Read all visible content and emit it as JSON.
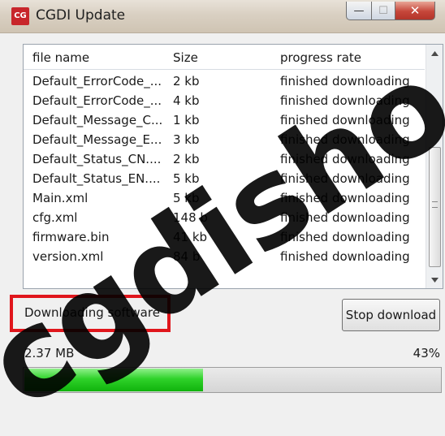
{
  "window": {
    "title": "CGDI Update",
    "icon": "cgdi-logo-icon",
    "icon_text": "CG",
    "controls": {
      "minimize": "—",
      "maximize": "☐",
      "close": "✕"
    }
  },
  "list": {
    "columns": [
      "file name",
      "Size",
      "progress rate"
    ],
    "rows": [
      [
        "Default_ErrorCode_...",
        "2 kb",
        "finished downloading"
      ],
      [
        "Default_ErrorCode_...",
        "4 kb",
        "finished downloading"
      ],
      [
        "Default_Message_C...",
        "1 kb",
        "finished downloading"
      ],
      [
        "Default_Message_E...",
        "3 kb",
        "finished downloading"
      ],
      [
        "Default_Status_CN....",
        "2 kb",
        "finished downloading"
      ],
      [
        "Default_Status_EN....",
        "5 kb",
        "finished downloading"
      ],
      [
        "Main.xml",
        "5 kb",
        "finished downloading"
      ],
      [
        "cfg.xml",
        "148 b",
        "finished downloading"
      ],
      [
        "firmware.bin",
        "41 kb",
        "finished downloading"
      ],
      [
        "version.xml",
        "84 b",
        "finished downloading"
      ]
    ]
  },
  "status": {
    "message": "Downloading software",
    "highlight_color": "#e0161c"
  },
  "stop_button": {
    "label": "Stop download"
  },
  "progress": {
    "size": "2.37 MB",
    "percent_label": "43%",
    "fraction": 0.43,
    "color": "#2fd22a"
  },
  "watermark": {
    "text": "cgdisho"
  }
}
